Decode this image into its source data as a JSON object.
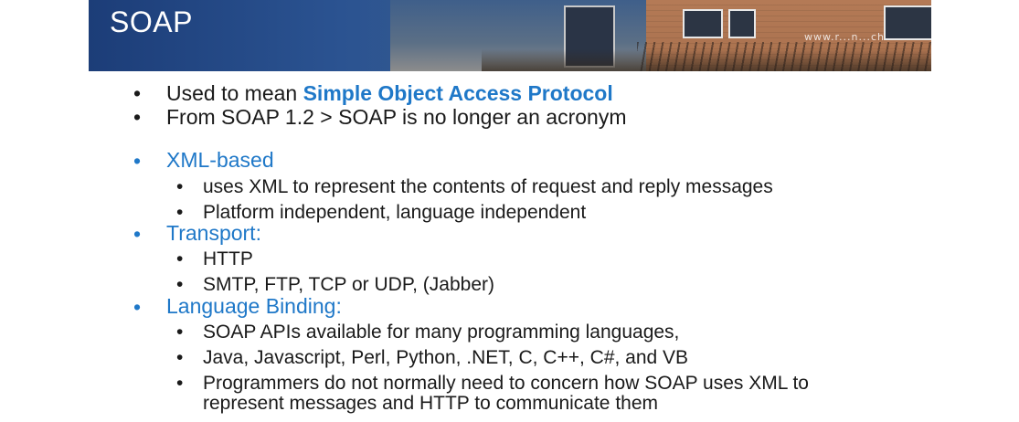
{
  "slide": {
    "title": "SOAP",
    "watermark": "www.r...n...ch",
    "bullets": {
      "b1_prefix": "Used to mean ",
      "b1_highlight": "Simple Object Access Protocol",
      "b2": "From SOAP 1.2 > SOAP is no longer an acronym",
      "xml_heading": "XML-based",
      "xml_sub1": "uses XML to represent the contents of request and reply messages",
      "xml_sub2": "Platform independent, language independent",
      "transport_heading": "Transport:",
      "transport_sub1": "HTTP",
      "transport_sub2": "SMTP, FTP, TCP or UDP, (Jabber)",
      "binding_heading": "Language Binding:",
      "binding_sub1": "SOAP APIs available for  many programming languages,",
      "binding_sub2": "Java, Javascript, Perl, Python, .NET, C, C++, C#, and VB",
      "binding_sub3_line1": "Programmers do not normally need to concern how SOAP uses XML to",
      "binding_sub3_line2": "represent messages and HTTP to communicate them"
    },
    "bullet_glyph": "•"
  },
  "colors": {
    "accent_blue": "#1f78c8",
    "text": "#1a1a1a",
    "banner_blue": "#1c3d78"
  }
}
